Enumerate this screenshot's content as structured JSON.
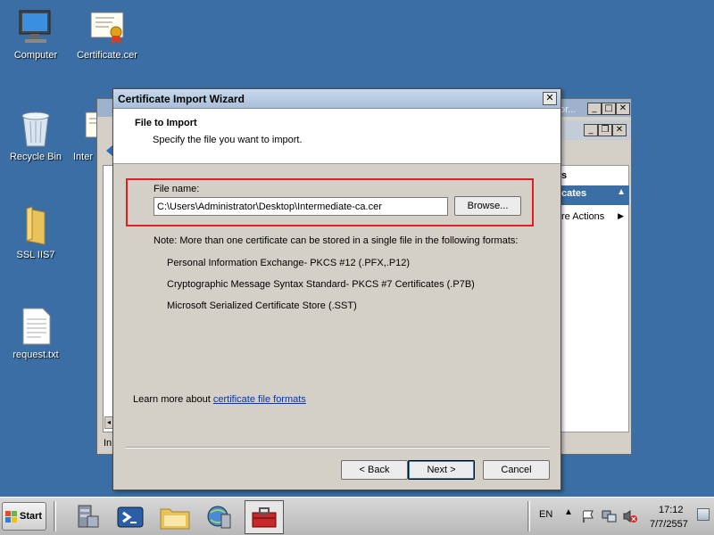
{
  "desktop": {
    "icons": [
      {
        "label": "Computer"
      },
      {
        "label": "Certificate.cer"
      },
      {
        "label": "Recycle Bin"
      },
      {
        "label": "Inter"
      },
      {
        "label": "SSL IIS7"
      },
      {
        "label": "request.txt"
      }
    ]
  },
  "background_window": {
    "title_fragment": "or...",
    "actions_header_fragment": "s",
    "certificates_fragment": "cates",
    "more_actions": "re Actions",
    "status_fragment": "In"
  },
  "wizard": {
    "title": "Certificate Import Wizard",
    "close_label": "✕",
    "heading": "File to Import",
    "subheading": "Specify the file you want to import.",
    "file_name_label": "File name:",
    "file_name_value": "C:\\Users\\Administrator\\Desktop\\Intermediate-ca.cer",
    "browse_label": "Browse...",
    "note": "Note:  More than one certificate can be stored in a single file in the following formats:",
    "formats": [
      "Personal Information Exchange- PKCS #12 (.PFX,.P12)",
      "Cryptographic Message Syntax Standard- PKCS #7 Certificates (.P7B)",
      "Microsoft Serialized Certificate Store (.SST)"
    ],
    "learn_more_prefix": "Learn more about ",
    "learn_more_link": "certificate file formats",
    "back_label": "< Back",
    "next_label": "Next >",
    "cancel_label": "Cancel"
  },
  "taskbar": {
    "start_label": "Start",
    "language": "EN",
    "time": "17:12",
    "date": "7/7/2557"
  },
  "colors": {
    "desktop": "#3a6ea5",
    "highlight_box": "#e02020",
    "link": "#0033cc",
    "actions_header": "#3a6ea5"
  }
}
